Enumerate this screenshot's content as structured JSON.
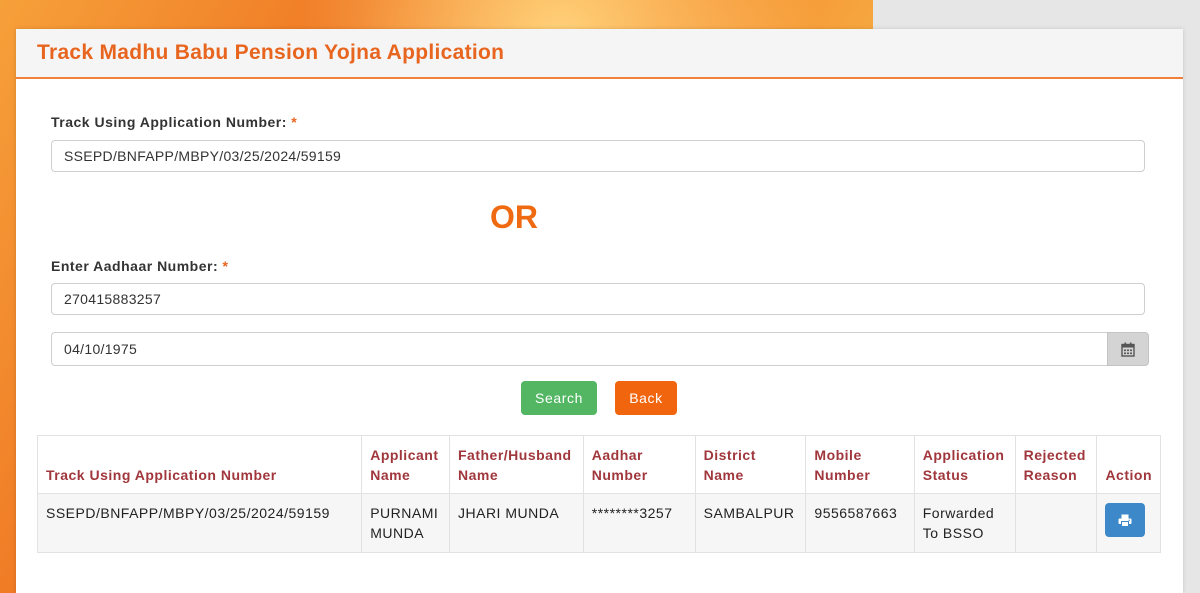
{
  "header": {
    "title": "Track Madhu Babu Pension Yojna Application"
  },
  "form": {
    "app_number_label": "Track Using Application Number:",
    "required_mark": "*",
    "app_number_value": "SSEPD/BNFAPP/MBPY/03/25/2024/59159",
    "or_text": "OR",
    "aadhaar_label": "Enter Aadhaar Number:",
    "aadhaar_value": "270415883257",
    "dob_value": "04/10/1975",
    "search_label": "Search",
    "back_label": "Back"
  },
  "table": {
    "headers": [
      "Track Using Application Number",
      "Applicant Name",
      "Father/Husband Name",
      "Aadhar Number",
      "District Name",
      "Mobile Number",
      "Application Status",
      "Rejected Reason",
      "Action"
    ],
    "rows": [
      {
        "app_number": "SSEPD/BNFAPP/MBPY/03/25/2024/59159",
        "applicant_name": "PURNAMI MUNDA",
        "father_husband_name": "JHARI MUNDA",
        "aadhar_number": "********3257",
        "district_name": "SAMBALPUR",
        "mobile_number": "9556587663",
        "status": "Forwarded To BSSO",
        "rejected_reason": ""
      }
    ]
  },
  "icons": {
    "calendar": "calendar-icon",
    "print": "print-icon"
  },
  "colors": {
    "accent": "#e8651f",
    "search": "#52b663",
    "back": "#f2650f",
    "print": "#3d88c9",
    "table_header": "#a0373c"
  }
}
